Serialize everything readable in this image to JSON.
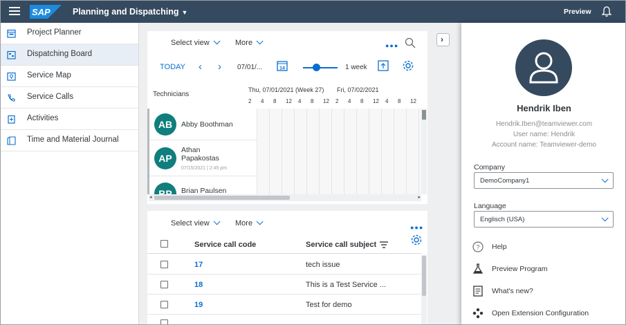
{
  "shell": {
    "logo_text": "SAP",
    "app_title": "Planning and Dispatching",
    "preview_label": "Preview"
  },
  "sidenav": {
    "items": [
      {
        "label": "Project Planner",
        "icon": "project-planner-icon"
      },
      {
        "label": "Dispatching Board",
        "icon": "dispatching-board-icon",
        "active": true
      },
      {
        "label": "Service Map",
        "icon": "map-icon"
      },
      {
        "label": "Service Calls",
        "icon": "phone-icon"
      },
      {
        "label": "Activities",
        "icon": "activities-icon"
      },
      {
        "label": "Time and Material Journal",
        "icon": "journal-icon"
      }
    ]
  },
  "board": {
    "select_view_label": "Select view",
    "more_label": "More",
    "today_label": "TODAY",
    "date_value": "07/01/...",
    "calendar_day": "14",
    "range_label": "1 week",
    "technicians_header": "Technicians",
    "day_headers": [
      "Thu, 07/01/2021 (Week 27)",
      "Fri, 07/02/2021"
    ],
    "hour_ticks": [
      "2",
      "4",
      "8",
      "12",
      "4",
      "8",
      "12",
      "2",
      "4",
      "8",
      "12",
      "4",
      "8",
      "12"
    ],
    "technicians": [
      {
        "initials": "AB",
        "name": "Abby Boothman",
        "sub": ""
      },
      {
        "initials": "AP",
        "name": "Athan Papakostas",
        "sub": "07/15/2021 | 2:45 pm"
      },
      {
        "initials": "BP",
        "name": "Brian Paulsen",
        "sub": ""
      }
    ]
  },
  "service_calls": {
    "select_view_label": "Select view",
    "more_label": "More",
    "columns": [
      "Service call code",
      "Service call subject"
    ],
    "rows": [
      {
        "code": "17",
        "subject": "tech issue"
      },
      {
        "code": "18",
        "subject": "This is a Test Service ..."
      },
      {
        "code": "19",
        "subject": "Test for demo"
      }
    ]
  },
  "user_panel": {
    "name": "Hendrik Iben",
    "email": "Hendrik.Iben@teamviewer.com",
    "user_name": "User name: Hendrik",
    "account_name": "Account name: Teamviewer-demo",
    "company_label": "Company",
    "company_value": "DemoCompany1",
    "language_label": "Language",
    "language_value": "Englisch (USA)",
    "items": [
      {
        "label": "Help",
        "icon": "help-icon"
      },
      {
        "label": "Preview Program",
        "icon": "flask-icon"
      },
      {
        "label": "What's new?",
        "icon": "whats-new-icon"
      },
      {
        "label": "Open Extension Configuration",
        "icon": "extension-icon"
      }
    ]
  },
  "colors": {
    "shell": "#354a5f",
    "accent": "#0a6ed1",
    "avatar": "#107e7d"
  }
}
